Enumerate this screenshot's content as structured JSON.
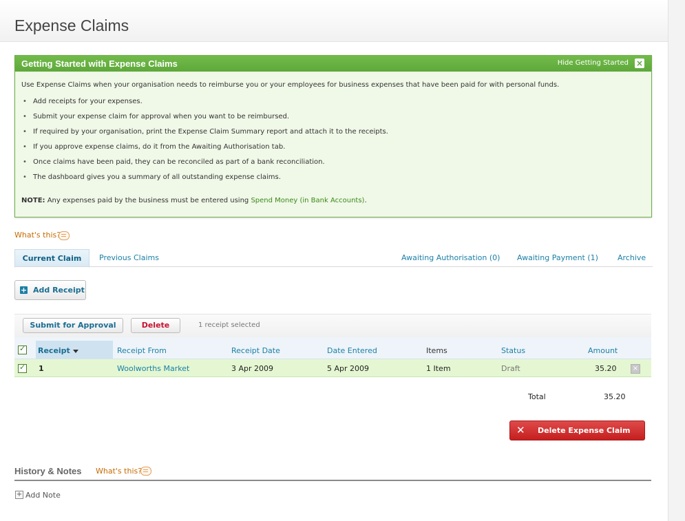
{
  "page": {
    "title": "Expense Claims"
  },
  "getting_started": {
    "title": "Getting Started with Expense Claims",
    "hide_label": "Hide Getting Started",
    "intro": "Use Expense Claims when your organisation needs to reimburse you or your employees for business expenses that have been paid for with personal funds.",
    "items": [
      "Add receipts for your expenses.",
      "Submit your expense claim for approval when you want to be reimbursed.",
      "If required by your organisation, print the Expense Claim Summary report and attach it to the receipts.",
      "If you approve expense claims, do it from the Awaiting Authorisation tab.",
      "Once claims have been paid, they can be reconciled as part of a bank reconciliation.",
      "The dashboard gives you a summary of all outstanding expense claims."
    ],
    "note_label": "NOTE:",
    "note_text": " Any expenses paid by the business must be entered using ",
    "note_link": "Spend Money (in Bank Accounts)",
    "note_end": "."
  },
  "whats_this": "What's this?",
  "tabs": {
    "current": "Current Claim",
    "previous": "Previous Claims",
    "awaiting_authorisation": "Awaiting Authorisation (0)",
    "awaiting_payment": "Awaiting Payment (1)",
    "archive": "Archive"
  },
  "actions": {
    "add_receipt": "Add Receipt",
    "submit": "Submit for Approval",
    "delete": "Delete",
    "selected": "1 receipt selected"
  },
  "table": {
    "columns": [
      "Receipt",
      "Receipt From",
      "Receipt Date",
      "Date Entered",
      "Items",
      "Status",
      "Amount"
    ],
    "rows": [
      {
        "receipt": "1",
        "from": "Woolworths Market",
        "receipt_date": "3 Apr 2009",
        "date_entered": "5 Apr 2009",
        "items": "1 Item",
        "status": "Draft",
        "amount": "35.20"
      }
    ],
    "total_label": "Total",
    "total_value": "35.20"
  },
  "delete_claim": "Delete Expense Claim",
  "history": {
    "title": "History & Notes",
    "add_note": "Add Note"
  }
}
